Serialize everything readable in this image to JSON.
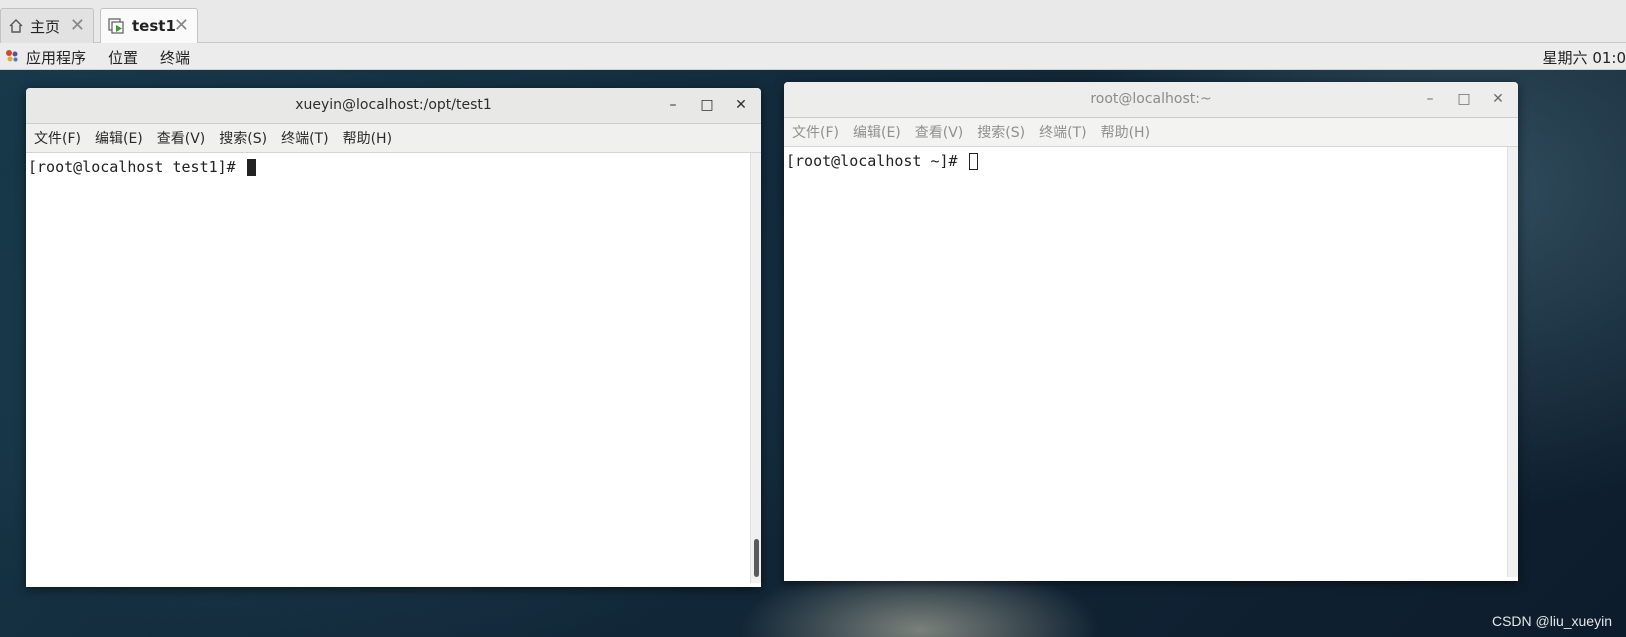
{
  "vm_tabs": [
    {
      "label": "主页",
      "icon": "home-icon",
      "close": "✕"
    },
    {
      "label": "test1",
      "icon": "vm-play-icon",
      "close": "✕"
    }
  ],
  "panel": {
    "menus": [
      "应用程序",
      "位置",
      "终端"
    ],
    "clock": "星期六 01:0"
  },
  "windows": {
    "left": {
      "title": "xueyin@localhost:/opt/test1",
      "menu": [
        "文件(F)",
        "编辑(E)",
        "查看(V)",
        "搜索(S)",
        "终端(T)",
        "帮助(H)"
      ],
      "prompt": "[root@localhost test1]# ",
      "focused": true
    },
    "right": {
      "title": "root@localhost:~",
      "menu": [
        "文件(F)",
        "编辑(E)",
        "查看(V)",
        "搜索(S)",
        "终端(T)",
        "帮助(H)"
      ],
      "prompt": "[root@localhost ~]# ",
      "focused": false
    }
  },
  "window_buttons": {
    "minimize": "–",
    "maximize": "□",
    "close": "✕"
  },
  "watermark": "CSDN @liu_xueyin"
}
